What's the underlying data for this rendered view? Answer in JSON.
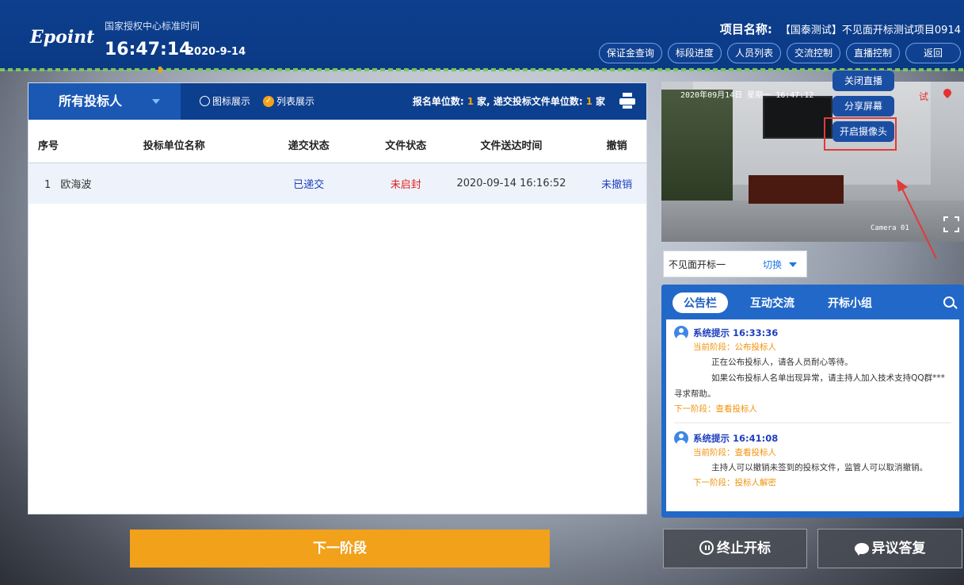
{
  "header": {
    "logo": "Epoint",
    "time_label": "国家授权中心标准时间",
    "clock": "16:47:14",
    "date": "2020-9-14",
    "project_key": "项目名称:",
    "project_value": "【国泰测试】不见面开标测试项目0914",
    "nav": [
      {
        "label": "保证金查询"
      },
      {
        "label": "标段进度"
      },
      {
        "label": "人员列表"
      },
      {
        "label": "交流控制"
      },
      {
        "label": "直播控制"
      },
      {
        "label": "返回"
      }
    ]
  },
  "live_popup": {
    "items": [
      {
        "label": "关闭直播"
      },
      {
        "label": "分享屏幕"
      },
      {
        "label": "开启摄像头"
      }
    ]
  },
  "bidders": {
    "dropdown_label": "所有投标人",
    "view_icon": "图标展示",
    "view_list": "列表展示",
    "stats_prefix": "报名单位数:",
    "registered_count": "1",
    "stats_mid": "家, 递交投标文件单位数:",
    "submitted_count": "1",
    "stats_suffix": "家",
    "columns": [
      "序号",
      "投标单位名称",
      "递交状态",
      "文件状态",
      "文件送达时间",
      "撤销"
    ],
    "rows": [
      {
        "index": "1",
        "name": "欧海波",
        "submit_status": "已递交",
        "file_status": "未启封",
        "time": "2020-09-14 16:16:52",
        "revoke": "未撤销"
      }
    ]
  },
  "camera": {
    "timestamp": "2020年09月14日 星期一 16:47:12",
    "camera_name": "Camera 01",
    "badge": "试"
  },
  "switch": {
    "label": "不见面开标一",
    "action": "切换"
  },
  "notice": {
    "tabs": [
      {
        "label": "公告栏"
      },
      {
        "label": "互动交流"
      },
      {
        "label": "开标小组"
      }
    ],
    "messages": [
      {
        "title": "系统提示 16:33:36",
        "stage": "当前阶段：公布投标人",
        "lines": [
          "正在公布投标人，请各人员耐心等待。",
          "如果公布投标人名单出现异常，请主持人加入技术支持QQ群***",
          "寻求帮助。"
        ],
        "next": "下一阶段：查看投标人"
      },
      {
        "title": "系统提示 16:41:08",
        "stage": "当前阶段：查看投标人",
        "lines": [
          "主持人可以撤销未签到的投标文件，监管人可以取消撤销。"
        ],
        "next": "下一阶段：投标人解密"
      }
    ]
  },
  "footer": {
    "next_stage": "下一阶段",
    "stop": "终止开标",
    "objection": "异议答复"
  },
  "colors": {
    "header_bg": "#0d3f8f",
    "accent_orange": "#f2a11b",
    "status_blue": "#1e3fbf",
    "status_red": "#e02020",
    "highlight_red": "#e23a3a"
  }
}
